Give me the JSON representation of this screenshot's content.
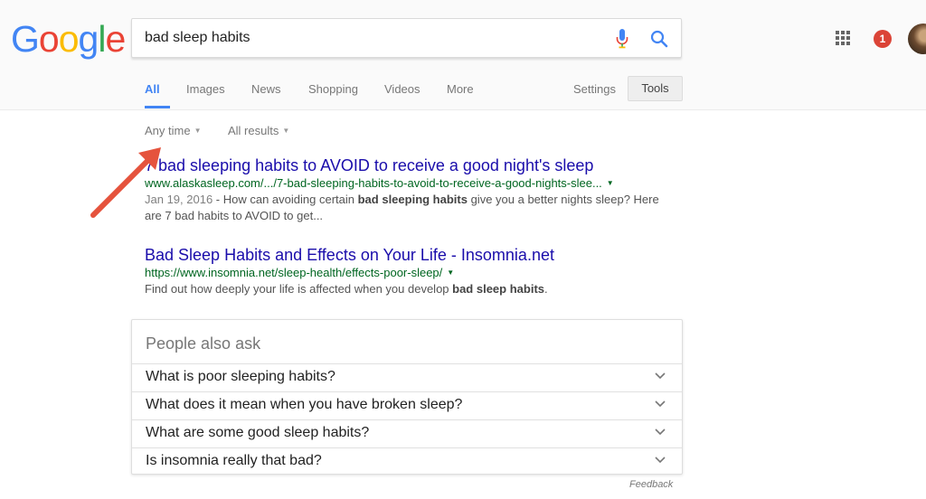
{
  "logo": {
    "letters": [
      "G",
      "o",
      "o",
      "g",
      "l",
      "e"
    ],
    "colors": [
      "#4285f4",
      "#ea4335",
      "#fbbc05",
      "#4285f4",
      "#34a853",
      "#ea4335"
    ]
  },
  "search": {
    "query": "bad sleep habits",
    "mic_icon": "mic-icon",
    "search_icon": "search-icon"
  },
  "header_right": {
    "apps_icon": "apps-grid-icon",
    "notification_count": "1",
    "notification_color": "#db4437"
  },
  "tabs": [
    {
      "label": "All",
      "active": true
    },
    {
      "label": "Images",
      "active": false
    },
    {
      "label": "News",
      "active": false
    },
    {
      "label": "Shopping",
      "active": false
    },
    {
      "label": "Videos",
      "active": false
    },
    {
      "label": "More",
      "active": false
    }
  ],
  "settings_label": "Settings",
  "tools_label": "Tools",
  "filters": {
    "time": "Any time",
    "results": "All results",
    "caret": "▼"
  },
  "results": [
    {
      "title": "7 bad sleeping habits to AVOID to receive a good night's sleep",
      "url": "www.alaskasleep.com/.../7-bad-sleeping-habits-to-avoid-to-receive-a-good-nights-slee...",
      "date": "Jan 19, 2016",
      "snippet_parts": [
        " - How can avoiding certain ",
        "bad sleeping habits",
        " give you a better nights sleep? Here are 7 bad habits to AVOID to get..."
      ]
    },
    {
      "title": "Bad Sleep Habits and Effects on Your Life - Insomnia.net",
      "url": "https://www.insomnia.net/sleep-health/effects-poor-sleep/",
      "snippet_parts": [
        "Find out how deeply your life is affected when you develop ",
        "bad sleep habits",
        "."
      ]
    }
  ],
  "people_also_ask": {
    "heading": "People also ask",
    "questions": [
      "What is poor sleeping habits?",
      "What does it mean when you have broken sleep?",
      "What are some good sleep habits?",
      "Is insomnia really that bad?"
    ]
  },
  "feedback_label": "Feedback",
  "colors": {
    "link": "#1a0dab",
    "url": "#006621",
    "accent": "#4285f4",
    "annotation_arrow": "#e5533d"
  }
}
